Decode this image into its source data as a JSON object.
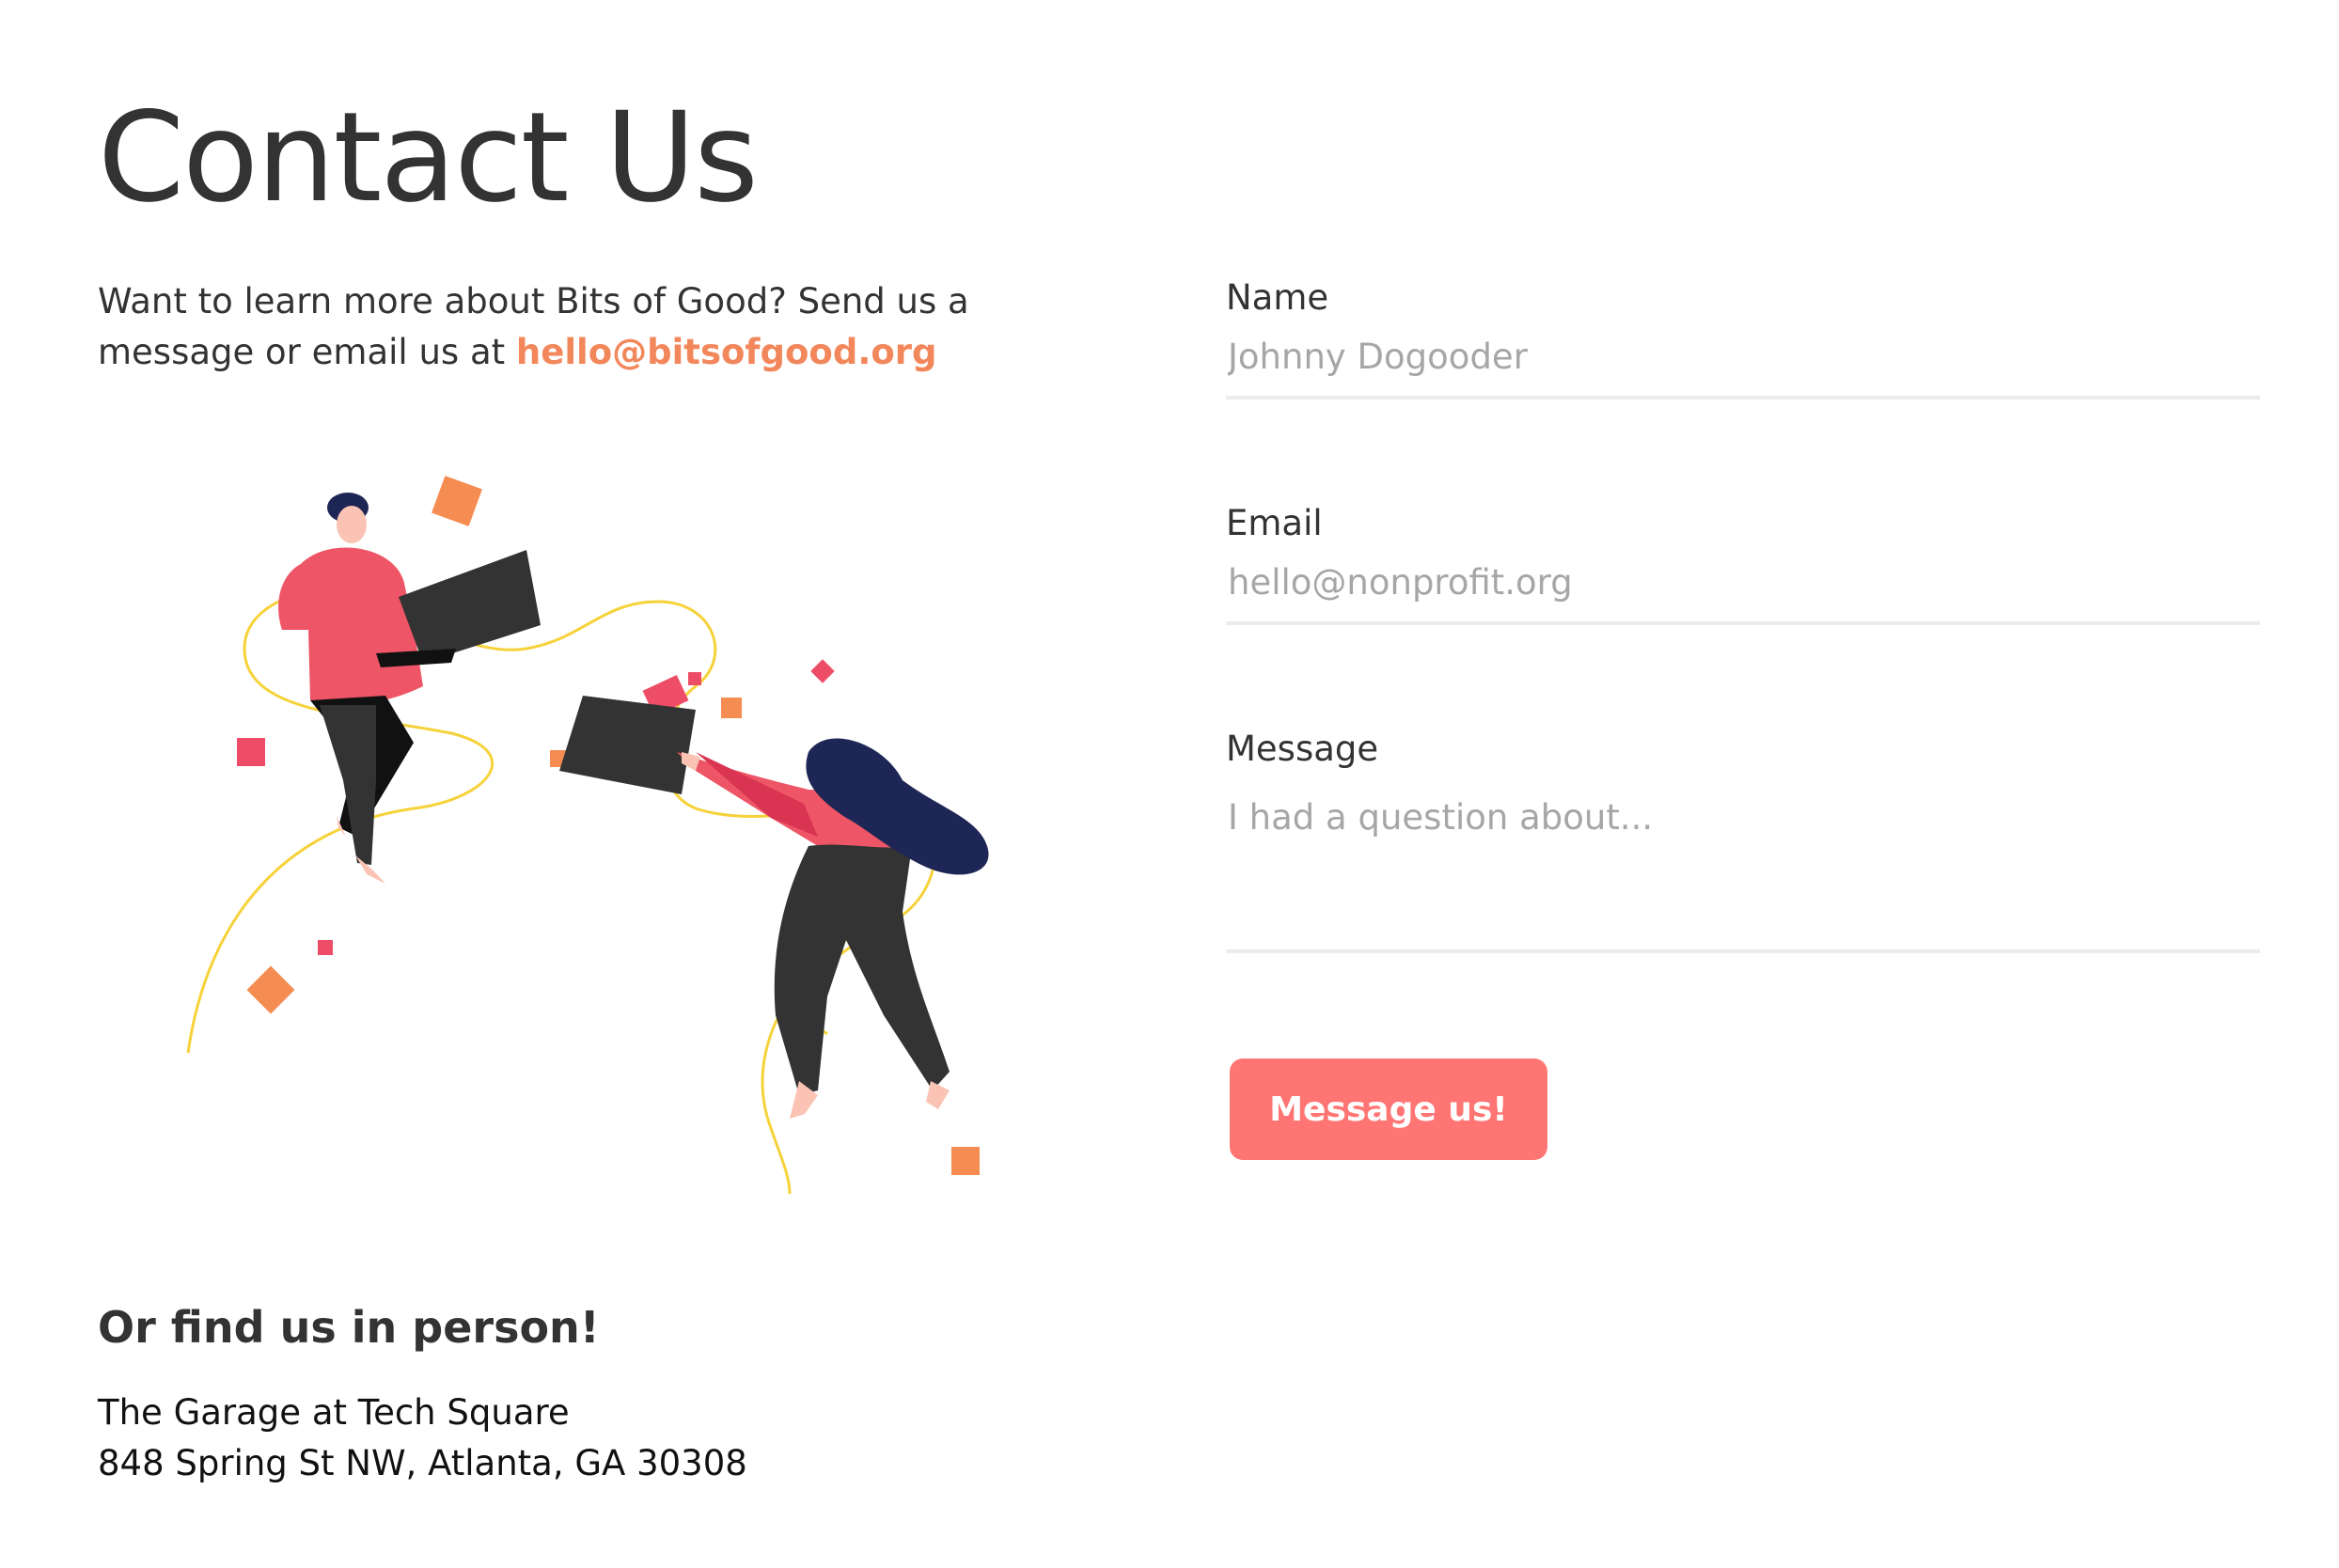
{
  "page": {
    "title": "Contact Us",
    "intro_text": "Want to learn more about Bits of Good? Send us a message or email us at",
    "intro_email": "hello@bitsofgood.org"
  },
  "form": {
    "name_label": "Name",
    "name_placeholder": "Johnny Dogooder",
    "email_label": "Email",
    "email_placeholder": "hello@nonprofit.org",
    "message_label": "Message",
    "message_placeholder": "I had a question about...",
    "submit_label": "Message us!"
  },
  "location": {
    "heading": "Or find us in person!",
    "line1": "The Garage at Tech Square",
    "line2": "848 Spring St NW, Atlanta, GA 30308"
  },
  "colors": {
    "accent": "#f2875b",
    "button": "#ff7573",
    "text": "#333333",
    "input_border": "#ececec",
    "placeholder": "#a6a6a6"
  },
  "illustration": {
    "icon": "two-people-exchanging-laptops-illustration"
  }
}
